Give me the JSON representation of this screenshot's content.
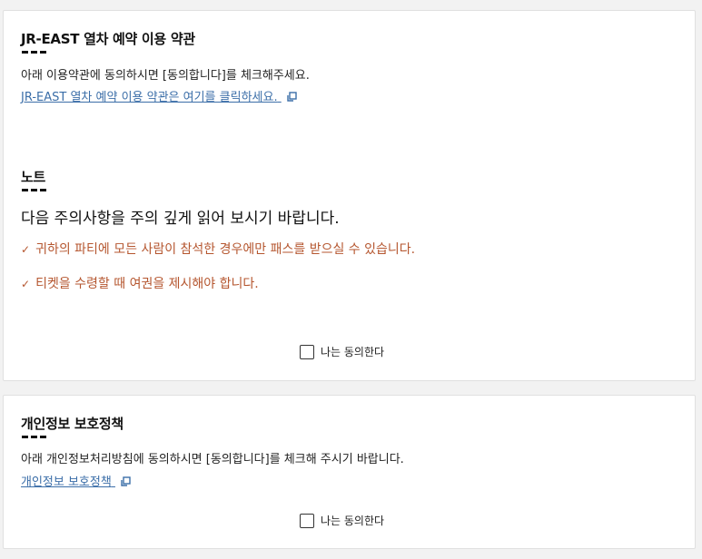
{
  "terms": {
    "title": "JR-EAST 열차 예약 이용 약관",
    "description": "아래 이용약관에 동의하시면 [동의합니다]를 체크해주세요.",
    "link_label": "JR-EAST 열차 예약 이용 약관은 여기를 클릭하세요.",
    "link_icon": "external-link-icon"
  },
  "notes": {
    "title": "노트",
    "lead": "다음 주의사항을 주의 깊게 읽어 보시기 바랍니다.",
    "check_icon": "✓",
    "items": [
      "귀하의 파티에 모든 사람이 참석한 경우에만 패스를 받으실 수 있습니다.",
      "티켓을 수령할 때 여권을 제시해야 합니다."
    ],
    "note_color": "#b5562f"
  },
  "terms_agree": {
    "label": "나는 동의한다",
    "checked": false
  },
  "privacy": {
    "title": "개인정보 보호정책",
    "description": "아래 개인정보처리방침에 동의하시면 [동의합니다]를 체크해 주시기 바랍니다.",
    "link_label": "개인정보 보호정책",
    "link_icon": "external-link-icon"
  },
  "privacy_agree": {
    "label": "나는 동의한다",
    "checked": false
  },
  "colors": {
    "link": "#3b6ea8",
    "background": "#f2f2f2",
    "card": "#ffffff"
  }
}
